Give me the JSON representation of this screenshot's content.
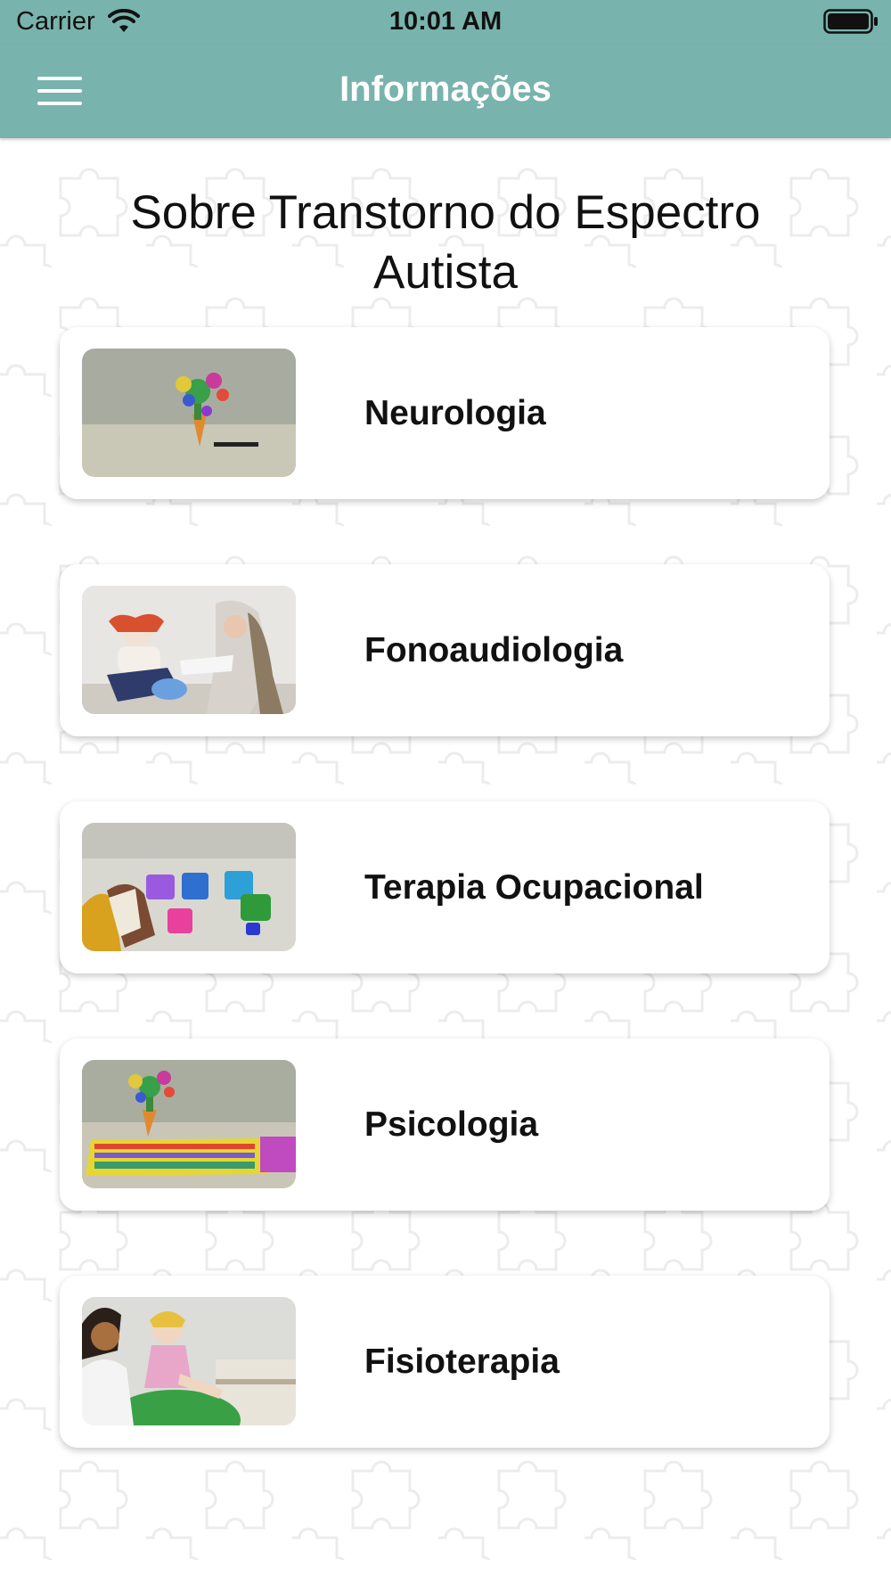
{
  "status_bar": {
    "carrier": "Carrier",
    "time": "10:01 AM"
  },
  "nav": {
    "title": "Informações",
    "menu_icon": "hamburger-menu-icon"
  },
  "heading": {
    "line1": "Sobre Transtorno do Espectro",
    "line2": "Autista"
  },
  "items": [
    {
      "label": "Neurologia",
      "image": "toy-tree-photo"
    },
    {
      "label": "Fonoaudiologia",
      "image": "therapist-with-doll-photo"
    },
    {
      "label": "Terapia Ocupacional",
      "image": "stacking-cups-photo"
    },
    {
      "label": "Psicologia",
      "image": "toy-tree-alphabet-mat-photo"
    },
    {
      "label": "Fisioterapia",
      "image": "therapist-doll-ball-photo"
    }
  ],
  "colors": {
    "header": "#79b3ad",
    "background": "#ffffff",
    "card": "#ffffff",
    "text": "#111111"
  }
}
